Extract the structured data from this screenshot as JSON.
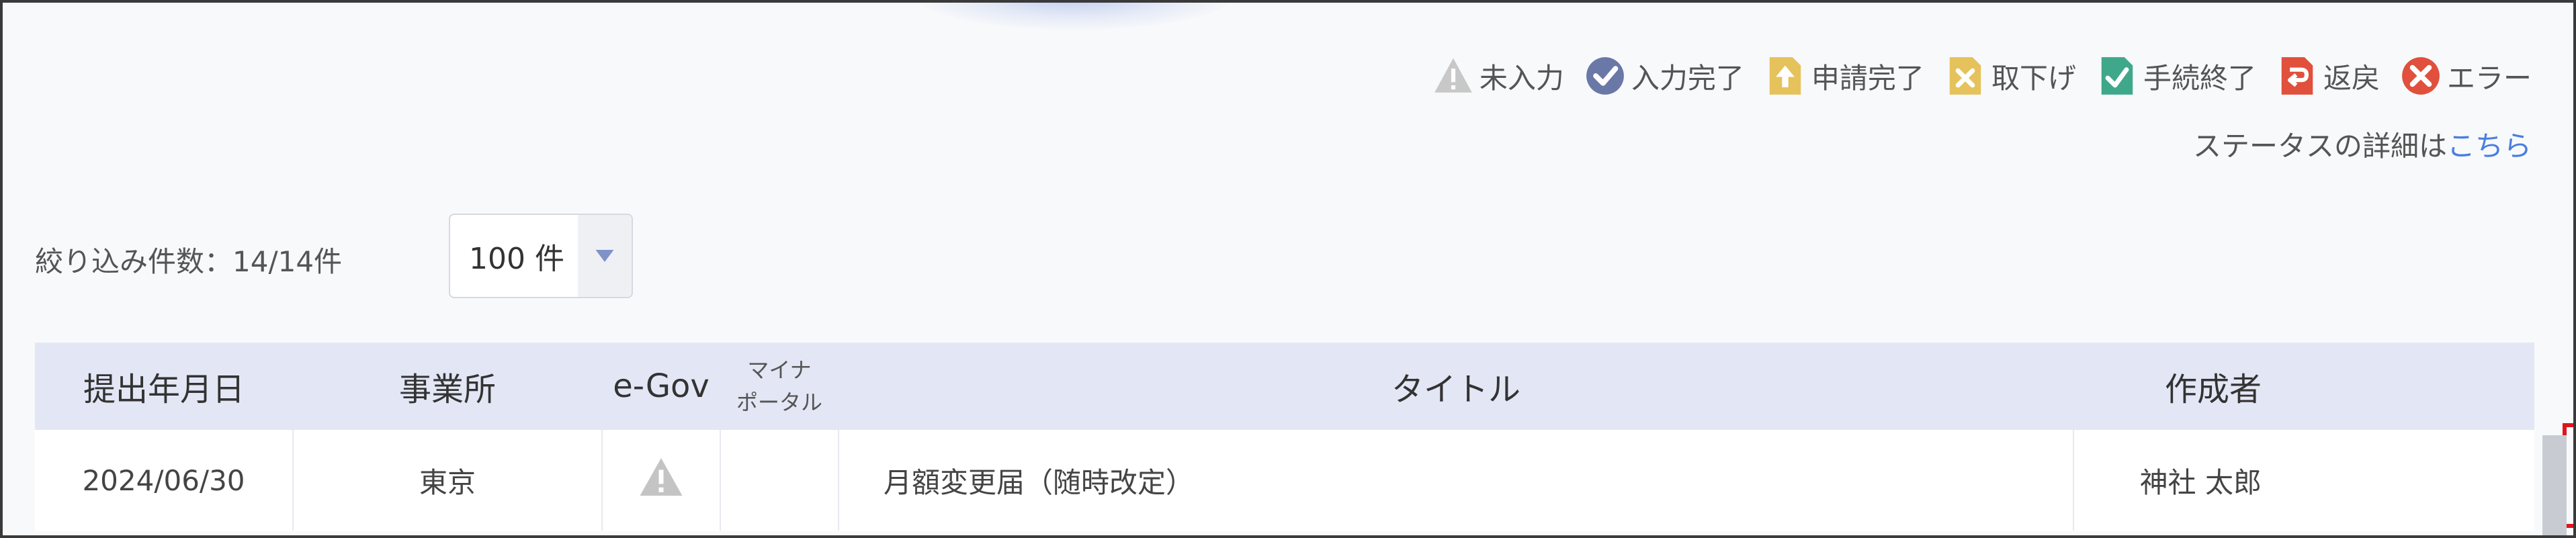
{
  "legend": [
    {
      "label": "未入力",
      "icon": "warning-triangle-icon",
      "color": "#c8c8c8"
    },
    {
      "label": "入力完了",
      "icon": "check-circle-icon",
      "color": "#6a78a8"
    },
    {
      "label": "申請完了",
      "icon": "upload-document-icon",
      "color": "#e5c25b"
    },
    {
      "label": "取下げ",
      "icon": "withdraw-document-icon",
      "color": "#e5c25b"
    },
    {
      "label": "手続終了",
      "icon": "complete-document-icon",
      "color": "#3fa88b"
    },
    {
      "label": "返戻",
      "icon": "return-document-icon",
      "color": "#e0503c"
    },
    {
      "label": "エラー",
      "icon": "error-circle-icon",
      "color": "#e0503c"
    }
  ],
  "status_detail": {
    "text": "ステータスの詳細は",
    "link": "こちら"
  },
  "filter": {
    "count_text": "絞り込み件数：14/14件",
    "page_size": "100 件"
  },
  "table": {
    "headers": {
      "date": "提出年月日",
      "office": "事業所",
      "egov": "e-Gov",
      "mynaportal_line1": "マイナ",
      "mynaportal_line2": "ポータル",
      "title": "タイトル",
      "author": "作成者",
      "actions": ""
    },
    "rows": [
      {
        "date": "2024/06/30",
        "office": "東京",
        "egov_status": "warning",
        "mynaportal": "",
        "title": "月額変更届（随時改定）",
        "author": "神社 太郎"
      }
    ]
  }
}
